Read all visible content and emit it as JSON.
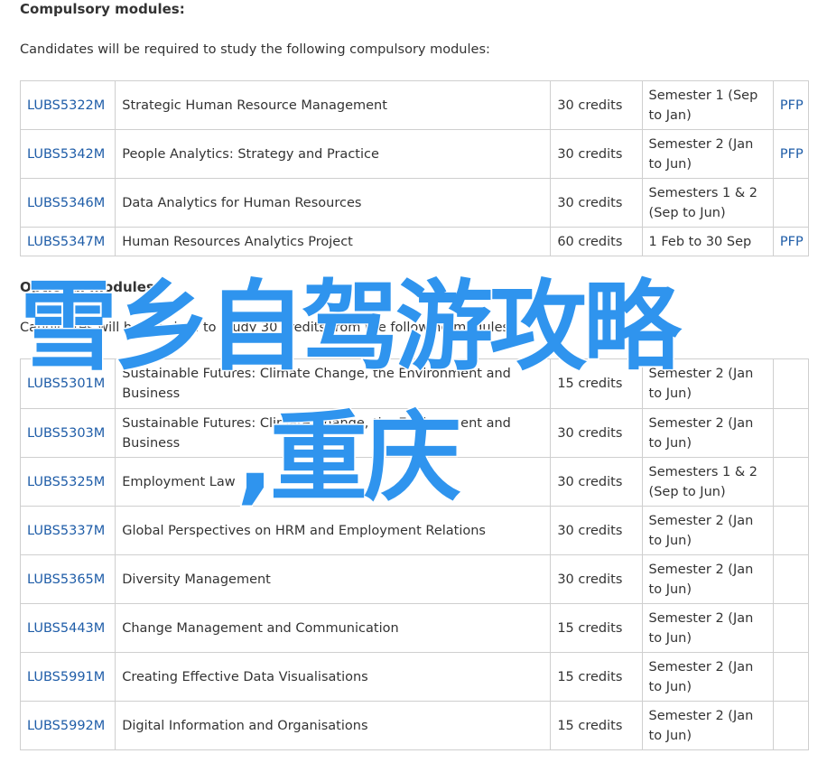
{
  "compulsory": {
    "heading": "Compulsory modules:",
    "intro": "Candidates will be required to study the following compulsory modules:",
    "rows": [
      {
        "code": "LUBS5322M",
        "title": "Strategic Human Resource Management",
        "credits": "30 credits",
        "semester": "Semester 1 (Sep to Jan)",
        "pfp": "PFP"
      },
      {
        "code": "LUBS5342M",
        "title": "People Analytics: Strategy and Practice",
        "credits": "30 credits",
        "semester": "Semester 2 (Jan to Jun)",
        "pfp": "PFP"
      },
      {
        "code": "LUBS5346M",
        "title": "Data Analytics for Human Resources",
        "credits": "30 credits",
        "semester": "Semesters 1 & 2 (Sep to Jun)",
        "pfp": ""
      },
      {
        "code": "LUBS5347M",
        "title": "Human Resources Analytics Project",
        "credits": "60 credits",
        "semester": "1 Feb to 30 Sep",
        "pfp": "PFP"
      }
    ]
  },
  "optional": {
    "heading": "Optional modules:",
    "intro": "Candidates will be required to study 30 credits from the following modules:",
    "rows": [
      {
        "code": "LUBS5301M",
        "title": "Sustainable Futures: Climate Change, the Environment and Business",
        "credits": "15 credits",
        "semester": "Semester 2 (Jan to Jun)",
        "pfp": ""
      },
      {
        "code": "LUBS5303M",
        "title": "Sustainable Futures: Climate Change, the Environment and Business",
        "credits": "30 credits",
        "semester": "Semester 2 (Jan to Jun)",
        "pfp": ""
      },
      {
        "code": "LUBS5325M",
        "title": "Employment Law",
        "credits": "30 credits",
        "semester": "Semesters 1 & 2 (Sep to Jun)",
        "pfp": ""
      },
      {
        "code": "LUBS5337M",
        "title": "Global Perspectives on HRM and Employment Relations",
        "credits": "30 credits",
        "semester": "Semester 2 (Jan to Jun)",
        "pfp": ""
      },
      {
        "code": "LUBS5365M",
        "title": "Diversity Management",
        "credits": "30 credits",
        "semester": "Semester 2 (Jan to Jun)",
        "pfp": ""
      },
      {
        "code": "LUBS5443M",
        "title": "Change Management and Communication",
        "credits": "15 credits",
        "semester": "Semester 2 (Jan to Jun)",
        "pfp": ""
      },
      {
        "code": "LUBS5991M",
        "title": "Creating Effective Data Visualisations",
        "credits": "15 credits",
        "semester": "Semester 2 (Jan to Jun)",
        "pfp": ""
      },
      {
        "code": "LUBS5992M",
        "title": "Digital Information and Organisations",
        "credits": "15 credits",
        "semester": "Semester 2 (Jan to Jun)",
        "pfp": ""
      }
    ]
  },
  "overlay": {
    "line1": "雪乡自驾游攻略",
    "line2": ",重庆",
    "color": "#2f94ee"
  },
  "colors": {
    "link": "#1f5da8",
    "border": "#cfcfcf",
    "text": "#333333"
  }
}
